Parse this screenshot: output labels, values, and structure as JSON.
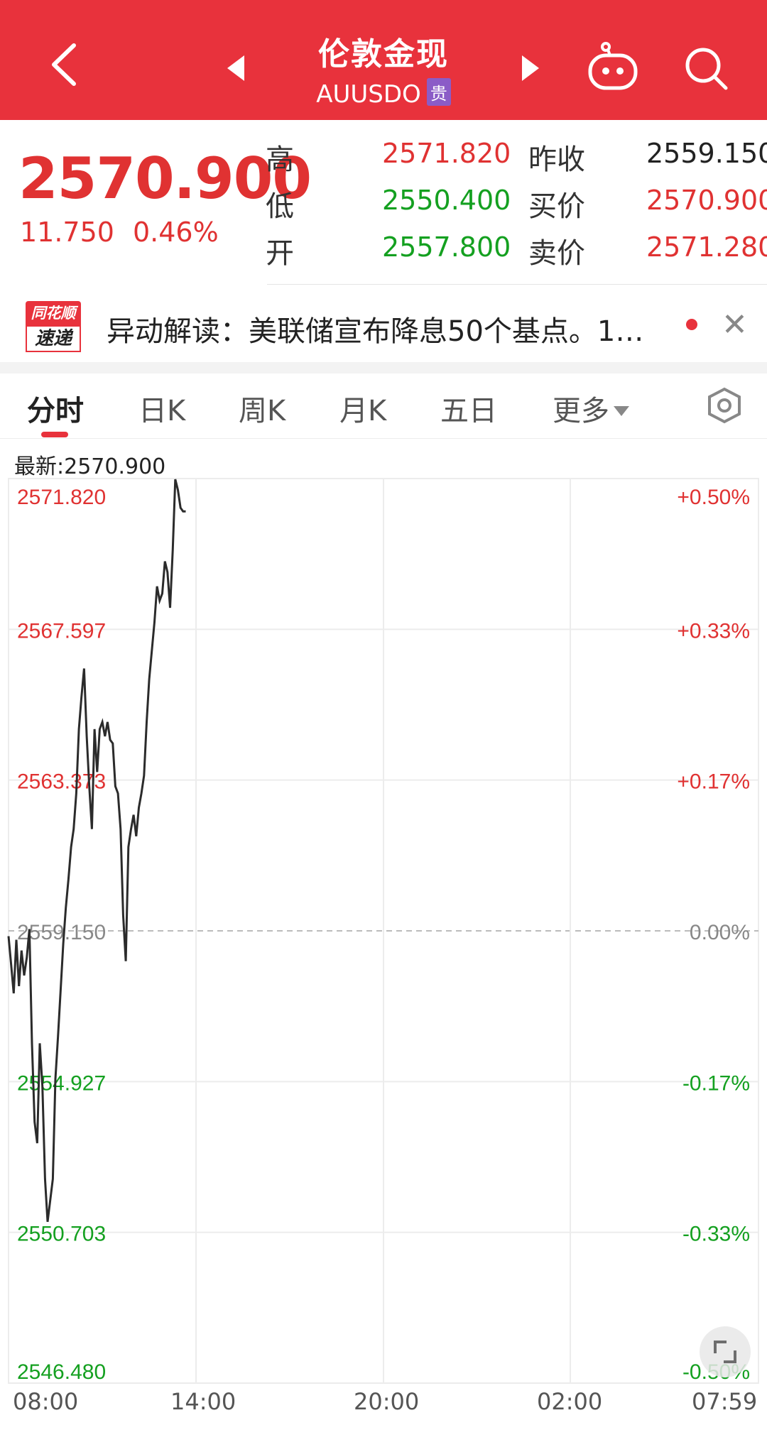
{
  "header": {
    "title": "伦敦金现",
    "code": "AUUSDO",
    "badge": "贵"
  },
  "quote": {
    "price": "2570.900",
    "change": "11.750",
    "change_pct": "0.46%",
    "rows": [
      {
        "label": "高",
        "value": "2571.820",
        "label2": "昨收",
        "value2": "2559.150"
      },
      {
        "label": "低",
        "value": "2550.400",
        "label2": "买价",
        "value2": "2570.900"
      },
      {
        "label": "开",
        "value": "2557.800",
        "label2": "卖价",
        "value2": "2571.280"
      }
    ]
  },
  "news": {
    "logo_top": "同花顺",
    "logo_bottom": "速递",
    "text": "异动解读：美联储宣布降息50个基点。1…"
  },
  "tabs": [
    "分时",
    "日K",
    "周K",
    "月K",
    "五日",
    "更多"
  ],
  "latest_label": "最新:2570.900",
  "colors": {
    "brand": "#e8323c",
    "up": "#e03232",
    "down": "#14a020",
    "badge": "#8b5cc7"
  },
  "chart_data": {
    "type": "line",
    "y_left_ticks": [
      "2571.820",
      "2567.597",
      "2563.373",
      "2559.150",
      "2554.927",
      "2550.703",
      "2546.480"
    ],
    "y_right_ticks": [
      "+0.50%",
      "+0.33%",
      "+0.17%",
      "0.00%",
      "-0.17%",
      "-0.33%",
      "-0.50%"
    ],
    "x_ticks": [
      "08:00",
      "14:00",
      "20:00",
      "02:00",
      "07:59"
    ],
    "ylim": [
      2546.48,
      2571.82
    ],
    "baseline": 2559.15,
    "series": [
      {
        "x": [
          "08:00",
          "08:05",
          "08:10",
          "08:15",
          "08:20",
          "08:25",
          "08:30",
          "08:35",
          "08:40",
          "08:45",
          "08:50",
          "08:55",
          "09:00",
          "09:05",
          "09:10",
          "09:15",
          "09:20",
          "09:25",
          "09:30",
          "09:35",
          "09:40",
          "09:45",
          "09:50",
          "09:55",
          "10:00",
          "10:05",
          "10:10",
          "10:15",
          "10:20",
          "10:25",
          "10:30",
          "10:35",
          "10:40",
          "10:45",
          "10:50",
          "10:55",
          "11:00",
          "11:05",
          "11:10",
          "11:15",
          "11:20",
          "11:25",
          "11:30",
          "11:35",
          "11:40",
          "11:45",
          "11:50",
          "11:55",
          "12:00",
          "12:05",
          "12:10",
          "12:15",
          "12:20",
          "12:25",
          "12:30",
          "12:35",
          "12:40",
          "12:45",
          "12:50",
          "12:55",
          "13:00",
          "13:05",
          "13:10",
          "13:15",
          "13:20",
          "13:25",
          "13:30",
          "13:35",
          "13:40"
        ],
        "values": [
          2559.0,
          2558.2,
          2557.4,
          2558.9,
          2557.6,
          2558.6,
          2557.9,
          2558.4,
          2559.2,
          2556.0,
          2553.8,
          2553.2,
          2556.0,
          2554.8,
          2552.2,
          2551.0,
          2551.6,
          2552.2,
          2555.0,
          2556.2,
          2557.5,
          2558.8,
          2559.8,
          2560.6,
          2561.5,
          2562.0,
          2563.0,
          2564.8,
          2565.7,
          2566.5,
          2564.6,
          2563.2,
          2562.0,
          2564.8,
          2563.6,
          2564.8,
          2565.0,
          2564.6,
          2565.0,
          2564.5,
          2564.4,
          2563.2,
          2563.0,
          2562.0,
          2559.6,
          2558.3,
          2561.5,
          2562.0,
          2562.4,
          2561.8,
          2562.6,
          2563.0,
          2563.5,
          2565.0,
          2566.2,
          2567.0,
          2567.8,
          2568.8,
          2568.4,
          2568.6,
          2569.5,
          2569.2,
          2568.2,
          2569.8,
          2571.8,
          2571.5,
          2571.0,
          2570.9,
          2570.9
        ]
      }
    ]
  }
}
